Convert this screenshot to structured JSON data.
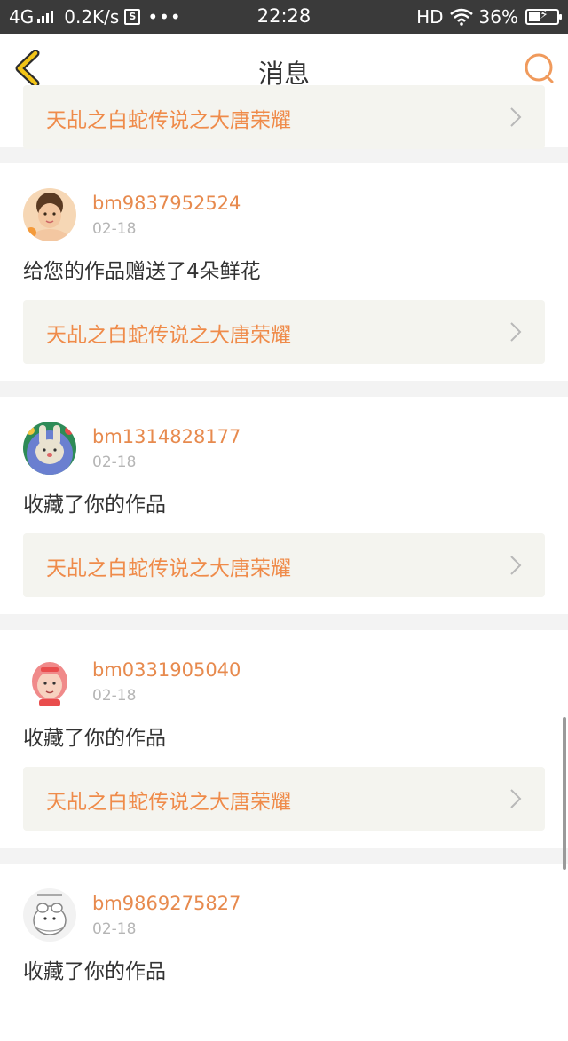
{
  "status_bar": {
    "network": "4G",
    "speed": "0.2K/s",
    "s_icon": "S",
    "more": "•••",
    "time": "22:28",
    "hd": "HD",
    "battery": "36%"
  },
  "header": {
    "title": "消息",
    "back_icon": "chevron-left-icon",
    "search_icon": "search-icon",
    "accent_color": "#e78a4e"
  },
  "first_card": {
    "work_title": "天乩之白蛇传说之大唐荣耀"
  },
  "messages": [
    {
      "username": "bm9837952524",
      "date": "02-18",
      "action": "给您的作品赠送了4朵鲜花",
      "work_title": "天乩之白蛇传说之大唐荣耀"
    },
    {
      "username": "bm1314828177",
      "date": "02-18",
      "action": "收藏了你的作品",
      "work_title": "天乩之白蛇传说之大唐荣耀"
    },
    {
      "username": "bm0331905040",
      "date": "02-18",
      "action": "收藏了你的作品",
      "work_title": "天乩之白蛇传说之大唐荣耀"
    },
    {
      "username": "bm9869275827",
      "date": "02-18",
      "action": "收藏了你的作品"
    }
  ]
}
